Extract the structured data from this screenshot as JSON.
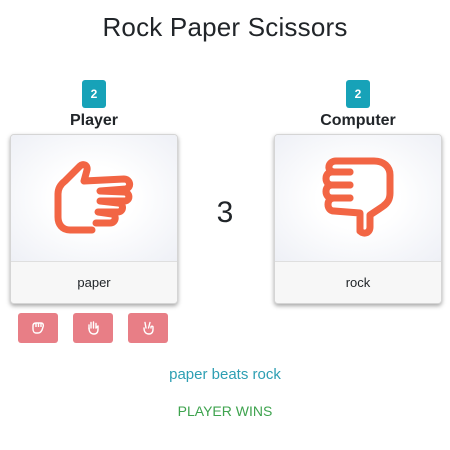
{
  "title": "Rock Paper Scissors",
  "player": {
    "label": "Player",
    "score": "2",
    "choice": "paper",
    "hand_icon": "paper-hand-icon"
  },
  "computer": {
    "label": "Computer",
    "score": "2",
    "choice": "rock",
    "hand_icon": "rock-fist-icon"
  },
  "countdown": "3",
  "choices": [
    {
      "name": "rock",
      "icon": "fist-icon"
    },
    {
      "name": "paper",
      "icon": "open-hand-icon"
    },
    {
      "name": "scissors",
      "icon": "scissors-hand-icon"
    }
  ],
  "result": {
    "message": "paper beats rock",
    "winner": "PLAYER WINS"
  },
  "colors": {
    "accent": "#17a2b8",
    "hand": "#f26544",
    "button": "#e87e86",
    "win": "#3ea34e",
    "info": "#2d9fb3"
  }
}
